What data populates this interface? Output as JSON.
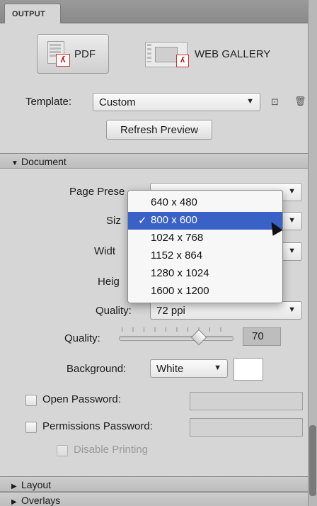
{
  "tabs": {
    "output": "OUTPUT"
  },
  "output_buttons": {
    "pdf": "PDF",
    "web_gallery": "WEB GALLERY"
  },
  "template": {
    "label": "Template:",
    "value": "Custom",
    "refresh": "Refresh Preview"
  },
  "sections": {
    "document": "Document",
    "layout": "Layout",
    "overlays": "Overlays"
  },
  "document": {
    "page_preset_label": "Page Prese",
    "size_label": "Siz",
    "width_label": "Widt",
    "height_label": "Heig",
    "quality_preset_label": "Quality:",
    "quality_preset_value": "72 ppi",
    "quality_slider_label": "Quality:",
    "quality_slider_value": "70",
    "quality_slider_level": 0.7,
    "background_label": "Background:",
    "background_value": "White",
    "background_color": "#ffffff",
    "open_password_label": "Open Password:",
    "permissions_password_label": "Permissions Password:",
    "disable_printing_label": "Disable Printing"
  },
  "size_menu": {
    "items": [
      "640 x 480",
      "800 x 600",
      "1024 x 768",
      "1152 x 864",
      "1280 x 1024",
      "1600 x 1200"
    ],
    "selected": "800 x 600",
    "check": "✓"
  },
  "colors": {
    "menu_highlight": "#3a61c6"
  }
}
